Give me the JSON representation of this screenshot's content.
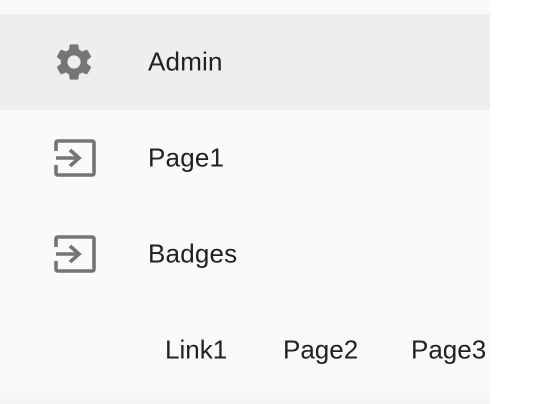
{
  "drawer": {
    "items": [
      {
        "label": "Admin",
        "icon": "gear-icon",
        "active": true
      },
      {
        "label": "Page1",
        "icon": "login-icon",
        "active": false
      },
      {
        "label": "Badges",
        "icon": "login-icon",
        "active": false
      }
    ],
    "links": [
      {
        "label": "Link1"
      },
      {
        "label": "Page2"
      },
      {
        "label": "Page3"
      }
    ]
  },
  "colors": {
    "drawer_bg": "#fafafa",
    "active_bg": "#eeeeee",
    "icon": "#757575",
    "text": "#212121"
  }
}
